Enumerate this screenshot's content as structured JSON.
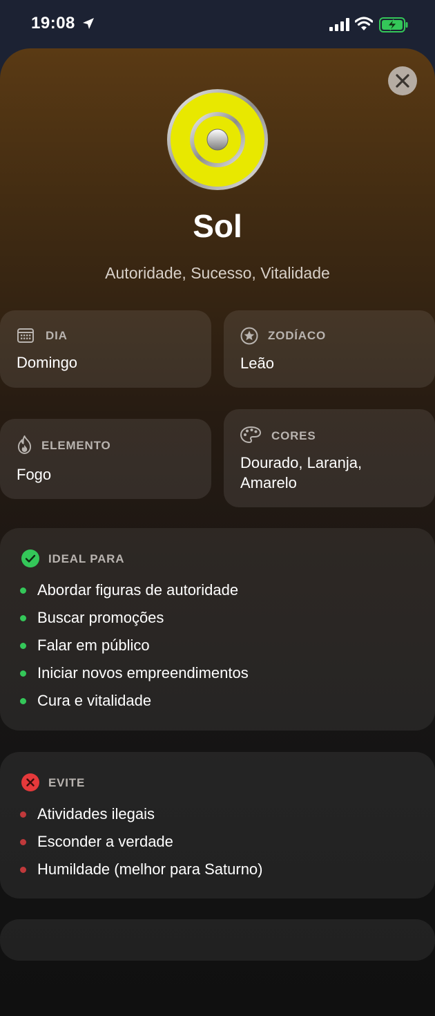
{
  "status": {
    "time": "19:08"
  },
  "header": {
    "title": "Sol",
    "subtitle": "Autoridade, Sucesso, Vitalidade"
  },
  "info": {
    "dia": {
      "label": "DIA",
      "value": "Domingo"
    },
    "zodiaco": {
      "label": "ZODÍACO",
      "value": "Leão"
    },
    "elemento": {
      "label": "ELEMENTO",
      "value": "Fogo"
    },
    "cores": {
      "label": "CORES",
      "value_line1": "Dourado, Laranja,",
      "value_line2": "Amarelo"
    }
  },
  "ideal": {
    "label": "IDEAL PARA",
    "items": [
      "Abordar figuras de autoridade",
      "Buscar promoções",
      "Falar em público",
      "Iniciar novos empreendimentos",
      "Cura e vitalidade"
    ]
  },
  "evite": {
    "label": "EVITE",
    "items": [
      "Atividades ilegais",
      "Esconder a verdade",
      "Humildade (melhor para Saturno)"
    ]
  },
  "colors": {
    "accent_green": "#34c759",
    "accent_red": "#e5393b",
    "sun_yellow": "#e8e800"
  }
}
